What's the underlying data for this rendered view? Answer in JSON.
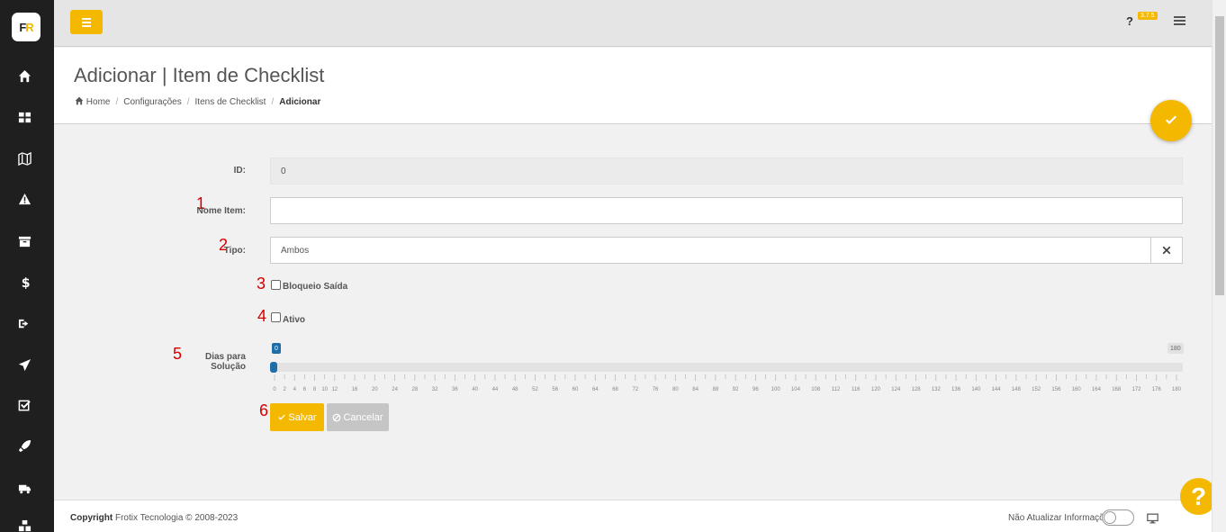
{
  "app": {
    "logo_text_left": "F",
    "logo_text_right": "R",
    "version": "3.7.5",
    "help_mark": "?"
  },
  "sidebar": {
    "items": [
      {
        "icon": "home-icon"
      },
      {
        "icon": "dashboard-icon"
      },
      {
        "icon": "map-icon"
      },
      {
        "icon": "warning-icon"
      },
      {
        "icon": "archive-icon"
      },
      {
        "icon": "dollar-icon"
      },
      {
        "icon": "sign-out-icon"
      },
      {
        "icon": "paper-plane-icon"
      },
      {
        "icon": "checklist-icon"
      },
      {
        "icon": "rocket-icon"
      },
      {
        "icon": "truck-icon"
      },
      {
        "icon": "cubes-icon"
      }
    ]
  },
  "header": {
    "title": "Adicionar | Item de Checklist",
    "breadcrumb": [
      "Home",
      "Configurações",
      "Itens de Checklist",
      "Adicionar"
    ]
  },
  "form": {
    "id": {
      "label": "ID:",
      "value": "0"
    },
    "nome_item": {
      "marker": "1",
      "label": "Nome Item:",
      "value": ""
    },
    "tipo": {
      "marker": "2",
      "label": "Tipo:",
      "value": "Ambos"
    },
    "bloqueio_saida": {
      "marker": "3",
      "label": "Bloqueio Saída",
      "checked": false
    },
    "ativo": {
      "marker": "4",
      "label": "Ativo",
      "checked": false
    },
    "dias_para_solucao": {
      "marker": "5",
      "label": "Dias para Solução",
      "value": "0",
      "min": 0,
      "max": "180",
      "tick_labels": [
        "0",
        "2",
        "4",
        "6",
        "8",
        "10",
        "12",
        "16",
        "20",
        "24",
        "28",
        "32",
        "36",
        "40",
        "44",
        "48",
        "52",
        "56",
        "60",
        "64",
        "68",
        "72",
        "76",
        "80",
        "84",
        "88",
        "92",
        "96",
        "100",
        "104",
        "108",
        "112",
        "116",
        "120",
        "124",
        "128",
        "132",
        "136",
        "140",
        "144",
        "148",
        "152",
        "156",
        "160",
        "164",
        "168",
        "172",
        "176",
        "180"
      ]
    },
    "buttons": {
      "marker": "6",
      "save_label": "Salvar",
      "cancel_label": "Cancelar"
    }
  },
  "footer": {
    "copyright_bold": "Copyright",
    "copyright_text": " Frotix Tecnologia © 2008-2023",
    "no_update_label": "Não Atualizar Informações",
    "no_update_enabled": false
  },
  "colors": {
    "accent": "#f5b800",
    "sidebar": "#1f1f1f",
    "slider": "#1e6fa8",
    "marker": "#d40000"
  }
}
